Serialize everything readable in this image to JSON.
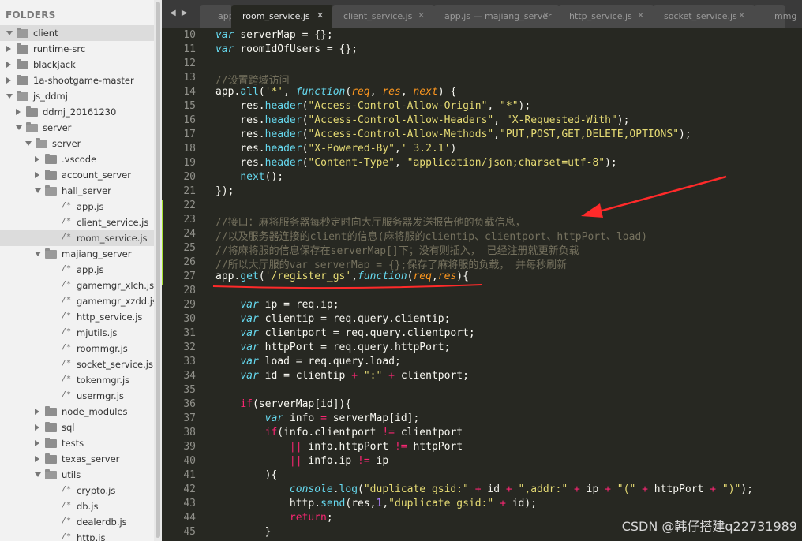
{
  "sidebar": {
    "header": "FOLDERS",
    "items": [
      {
        "label": "client",
        "kind": "folder",
        "expanded": true,
        "depth": 0,
        "selected": true
      },
      {
        "label": "runtime-src",
        "kind": "folder",
        "expanded": false,
        "depth": 0
      },
      {
        "label": "blackjack",
        "kind": "folder",
        "expanded": false,
        "depth": 0
      },
      {
        "label": "1a-shootgame-master",
        "kind": "folder",
        "expanded": false,
        "depth": 0
      },
      {
        "label": "js_ddmj",
        "kind": "folder",
        "expanded": true,
        "depth": 0
      },
      {
        "label": "ddmj_20161230",
        "kind": "folder",
        "expanded": false,
        "depth": 1
      },
      {
        "label": "server",
        "kind": "folder",
        "expanded": true,
        "depth": 1
      },
      {
        "label": "server",
        "kind": "folder",
        "expanded": true,
        "depth": 2
      },
      {
        "label": ".vscode",
        "kind": "folder",
        "expanded": false,
        "depth": 3
      },
      {
        "label": "account_server",
        "kind": "folder",
        "expanded": false,
        "depth": 3
      },
      {
        "label": "hall_server",
        "kind": "folder",
        "expanded": true,
        "depth": 3
      },
      {
        "label": "app.js",
        "kind": "file",
        "depth": 4
      },
      {
        "label": "client_service.js",
        "kind": "file",
        "depth": 4
      },
      {
        "label": "room_service.js",
        "kind": "file",
        "depth": 4,
        "selected": true
      },
      {
        "label": "majiang_server",
        "kind": "folder",
        "expanded": true,
        "depth": 3
      },
      {
        "label": "app.js",
        "kind": "file",
        "depth": 4
      },
      {
        "label": "gamemgr_xlch.js",
        "kind": "file",
        "depth": 4
      },
      {
        "label": "gamemgr_xzdd.js",
        "kind": "file",
        "depth": 4
      },
      {
        "label": "http_service.js",
        "kind": "file",
        "depth": 4
      },
      {
        "label": "mjutils.js",
        "kind": "file",
        "depth": 4
      },
      {
        "label": "roommgr.js",
        "kind": "file",
        "depth": 4
      },
      {
        "label": "socket_service.js",
        "kind": "file",
        "depth": 4
      },
      {
        "label": "tokenmgr.js",
        "kind": "file",
        "depth": 4
      },
      {
        "label": "usermgr.js",
        "kind": "file",
        "depth": 4
      },
      {
        "label": "node_modules",
        "kind": "folder",
        "expanded": false,
        "depth": 3
      },
      {
        "label": "sql",
        "kind": "folder",
        "expanded": false,
        "depth": 3
      },
      {
        "label": "tests",
        "kind": "folder",
        "expanded": false,
        "depth": 3
      },
      {
        "label": "texas_server",
        "kind": "folder",
        "expanded": false,
        "depth": 3
      },
      {
        "label": "utils",
        "kind": "folder",
        "expanded": true,
        "depth": 3
      },
      {
        "label": "crypto.js",
        "kind": "file",
        "depth": 4
      },
      {
        "label": "db.js",
        "kind": "file",
        "depth": 4
      },
      {
        "label": "dealerdb.js",
        "kind": "file",
        "depth": 4
      },
      {
        "label": "http.js",
        "kind": "file",
        "depth": 4
      }
    ],
    "file_icon_glyph": "/*"
  },
  "tabbar": {
    "nav_arrows": "◀ ▶",
    "tabs": [
      {
        "label": "app",
        "close": "",
        "active": false
      },
      {
        "label": "room_service.js",
        "close": "✕",
        "active": true
      },
      {
        "label": "client_service.js",
        "close": "✕",
        "active": false
      },
      {
        "label": "app.js — majiang_server",
        "close": "✕",
        "active": false
      },
      {
        "label": "http_service.js",
        "close": "✕",
        "active": false
      },
      {
        "label": "socket_service.js",
        "close": "✕",
        "active": false
      },
      {
        "label": "mmg",
        "close": "",
        "active": false
      }
    ]
  },
  "editor": {
    "theme_colors": {
      "background": "#272822",
      "text": "#f8f8f2",
      "keyword": "#f92672",
      "storage": "#66d9ef",
      "string": "#e6db74",
      "comment": "#75715e",
      "param": "#fd971f",
      "number": "#ae81ff"
    },
    "lines": [
      {
        "num": "10",
        "tokens": [
          [
            "k",
            "var"
          ],
          [
            "",
            "serverMap = {};"
          ]
        ]
      },
      {
        "num": "11",
        "tokens": [
          [
            "k",
            "var"
          ],
          [
            "",
            "roomIdOfUsers = {};"
          ]
        ]
      },
      {
        "num": "12",
        "tokens": []
      },
      {
        "num": "13",
        "tokens": [
          [
            "c",
            "//设置跨域访问"
          ]
        ]
      },
      {
        "num": "14",
        "tokens": [
          [
            "",
            "app."
          ],
          [
            "f",
            "all"
          ],
          [
            "",
            "("
          ],
          [
            "s",
            "'*'"
          ],
          [
            "",
            ", "
          ],
          [
            "k",
            "function"
          ],
          [
            "",
            "("
          ],
          [
            "p",
            "req"
          ],
          [
            "",
            ", "
          ],
          [
            "p",
            "res"
          ],
          [
            "",
            ", "
          ],
          [
            "p",
            "next"
          ],
          [
            "",
            ") {"
          ]
        ]
      },
      {
        "num": "15",
        "tokens": [
          [
            "",
            "    res."
          ],
          [
            "f",
            "header"
          ],
          [
            "",
            "("
          ],
          [
            "s",
            "\"Access-Control-Allow-Origin\""
          ],
          [
            "",
            ", "
          ],
          [
            "s",
            "\"*\""
          ],
          [
            "",
            ");"
          ]
        ]
      },
      {
        "num": "16",
        "tokens": [
          [
            "",
            "    res."
          ],
          [
            "f",
            "header"
          ],
          [
            "",
            "("
          ],
          [
            "s",
            "\"Access-Control-Allow-Headers\""
          ],
          [
            "",
            ", "
          ],
          [
            "s",
            "\"X-Requested-With\""
          ],
          [
            "",
            ");"
          ]
        ]
      },
      {
        "num": "17",
        "tokens": [
          [
            "",
            "    res."
          ],
          [
            "f",
            "header"
          ],
          [
            "",
            "("
          ],
          [
            "s",
            "\"Access-Control-Allow-Methods\""
          ],
          [
            "",
            ","
          ],
          [
            "s",
            "\"PUT,POST,GET,DELETE,OPTIONS\""
          ],
          [
            "",
            ");"
          ]
        ]
      },
      {
        "num": "18",
        "tokens": [
          [
            "",
            "    res."
          ],
          [
            "f",
            "header"
          ],
          [
            "",
            "("
          ],
          [
            "s",
            "\"X-Powered-By\""
          ],
          [
            "",
            ","
          ],
          [
            "s",
            "' 3.2.1'"
          ],
          [
            "",
            ")"
          ]
        ]
      },
      {
        "num": "19",
        "tokens": [
          [
            "",
            "    res."
          ],
          [
            "f",
            "header"
          ],
          [
            "",
            "("
          ],
          [
            "s",
            "\"Content-Type\""
          ],
          [
            "",
            ", "
          ],
          [
            "s",
            "\"application/json;charset=utf-8\""
          ],
          [
            "",
            ");"
          ]
        ]
      },
      {
        "num": "20",
        "tokens": [
          [
            "",
            "    "
          ],
          [
            "f",
            "next"
          ],
          [
            "",
            "();"
          ]
        ]
      },
      {
        "num": "21",
        "tokens": [
          [
            "",
            "});"
          ]
        ]
      },
      {
        "num": "22",
        "tokens": []
      },
      {
        "num": "23",
        "tokens": [
          [
            "c",
            "//接口：麻将服务器每秒定时向大厅服务器发送报告他的负载信息，"
          ]
        ]
      },
      {
        "num": "24",
        "tokens": [
          [
            "c",
            "//以及服务器连接的client的信息(麻将服的clientip、clientport、httpPort、load)"
          ]
        ]
      },
      {
        "num": "25",
        "tokens": [
          [
            "c",
            "//将麻将服的信息保存在serverMap[]下；没有则插入， 已经注册就更新负载"
          ]
        ]
      },
      {
        "num": "26",
        "tokens": [
          [
            "c",
            "//所以大厅服的var serverMap = {};保存了麻将服的负载， 并每秒刷新"
          ]
        ]
      },
      {
        "num": "27",
        "tokens": [
          [
            "",
            "app."
          ],
          [
            "f",
            "get"
          ],
          [
            "",
            "("
          ],
          [
            "s",
            "'/register_gs'"
          ],
          [
            "",
            ","
          ],
          [
            "k",
            "function"
          ],
          [
            "",
            "("
          ],
          [
            "p",
            "req"
          ],
          [
            "",
            ","
          ],
          [
            "p",
            "res"
          ],
          [
            "",
            "){"
          ]
        ]
      },
      {
        "num": "28",
        "tokens": []
      },
      {
        "num": "29",
        "tokens": [
          [
            "",
            "    "
          ],
          [
            "k",
            "var"
          ],
          [
            "",
            "ip = req.ip;"
          ]
        ]
      },
      {
        "num": "30",
        "tokens": [
          [
            "",
            "    "
          ],
          [
            "k",
            "var"
          ],
          [
            "",
            "clientip = req.query.clientip;"
          ]
        ]
      },
      {
        "num": "31",
        "tokens": [
          [
            "",
            "    "
          ],
          [
            "k",
            "var"
          ],
          [
            "",
            "clientport = req.query.clientport;"
          ]
        ]
      },
      {
        "num": "32",
        "tokens": [
          [
            "",
            "    "
          ],
          [
            "k",
            "var"
          ],
          [
            "",
            "httpPort = req.query.httpPort;"
          ]
        ]
      },
      {
        "num": "33",
        "tokens": [
          [
            "",
            "    "
          ],
          [
            "k",
            "var"
          ],
          [
            "",
            "load = req.query.load;"
          ]
        ]
      },
      {
        "num": "34",
        "tokens": [
          [
            "",
            "    "
          ],
          [
            "k",
            "var"
          ],
          [
            "",
            "id = clientip "
          ],
          [
            "kw",
            "+"
          ],
          [
            "",
            ""
          ],
          [
            "s",
            " \":\" "
          ],
          [
            "kw",
            "+"
          ],
          [
            "",
            " clientport;"
          ]
        ]
      },
      {
        "num": "35",
        "tokens": []
      },
      {
        "num": "36",
        "tokens": [
          [
            "",
            "    "
          ],
          [
            "kw",
            "if"
          ],
          [
            "",
            "(serverMap[id]){"
          ]
        ]
      },
      {
        "num": "37",
        "tokens": [
          [
            "",
            "        "
          ],
          [
            "k",
            "var"
          ],
          [
            "",
            "info "
          ],
          [
            "kw",
            "="
          ],
          [
            "",
            " serverMap[id];"
          ]
        ]
      },
      {
        "num": "38",
        "tokens": [
          [
            "",
            "        "
          ],
          [
            "kw",
            "if"
          ],
          [
            "",
            "(info.clientport "
          ],
          [
            "kw",
            "!="
          ],
          [
            "",
            " clientport"
          ]
        ]
      },
      {
        "num": "39",
        "tokens": [
          [
            "",
            "            "
          ],
          [
            "kw",
            "||"
          ],
          [
            "",
            " info.httpPort "
          ],
          [
            "kw",
            "!="
          ],
          [
            "",
            " httpPort"
          ]
        ]
      },
      {
        "num": "40",
        "tokens": [
          [
            "",
            "            "
          ],
          [
            "kw",
            "||"
          ],
          [
            "",
            " info.ip "
          ],
          [
            "kw",
            "!="
          ],
          [
            "",
            " ip"
          ]
        ]
      },
      {
        "num": "41",
        "tokens": [
          [
            "",
            "        ){"
          ]
        ]
      },
      {
        "num": "42",
        "tokens": [
          [
            "",
            "            "
          ],
          [
            "k",
            "console"
          ],
          [
            "",
            "."
          ],
          [
            "f",
            "log"
          ],
          [
            "",
            "("
          ],
          [
            "s",
            "\"duplicate gsid:\""
          ],
          [
            "",
            " "
          ],
          [
            "kw",
            "+"
          ],
          [
            "",
            " id "
          ],
          [
            "kw",
            "+"
          ],
          [
            "",
            " "
          ],
          [
            "s",
            "\",addr:\""
          ],
          [
            "",
            " "
          ],
          [
            "kw",
            "+"
          ],
          [
            "",
            " ip "
          ],
          [
            "kw",
            "+"
          ],
          [
            "",
            " "
          ],
          [
            "s",
            "\"(\""
          ],
          [
            "",
            " "
          ],
          [
            "kw",
            "+"
          ],
          [
            "",
            " httpPort "
          ],
          [
            "kw",
            "+"
          ],
          [
            "",
            " "
          ],
          [
            "s",
            "\")\""
          ],
          [
            "",
            ");"
          ]
        ]
      },
      {
        "num": "43",
        "tokens": [
          [
            "",
            "            http."
          ],
          [
            "f",
            "send"
          ],
          [
            "",
            "(res,"
          ],
          [
            "n",
            "1"
          ],
          [
            "",
            ","
          ],
          [
            "s",
            "\"duplicate gsid:\""
          ],
          [
            "",
            " "
          ],
          [
            "kw",
            "+"
          ],
          [
            "",
            " id);"
          ]
        ]
      },
      {
        "num": "44",
        "tokens": [
          [
            "",
            "            "
          ],
          [
            "kw",
            "return"
          ],
          [
            "",
            ";"
          ]
        ]
      },
      {
        "num": "45",
        "tokens": [
          [
            "",
            "        }"
          ]
        ]
      }
    ]
  },
  "annotations": {
    "arrow_color": "#ff2a2a",
    "underline_color": "#ff2a2a"
  },
  "watermark": "CSDN @韩仔搭建q22731989"
}
